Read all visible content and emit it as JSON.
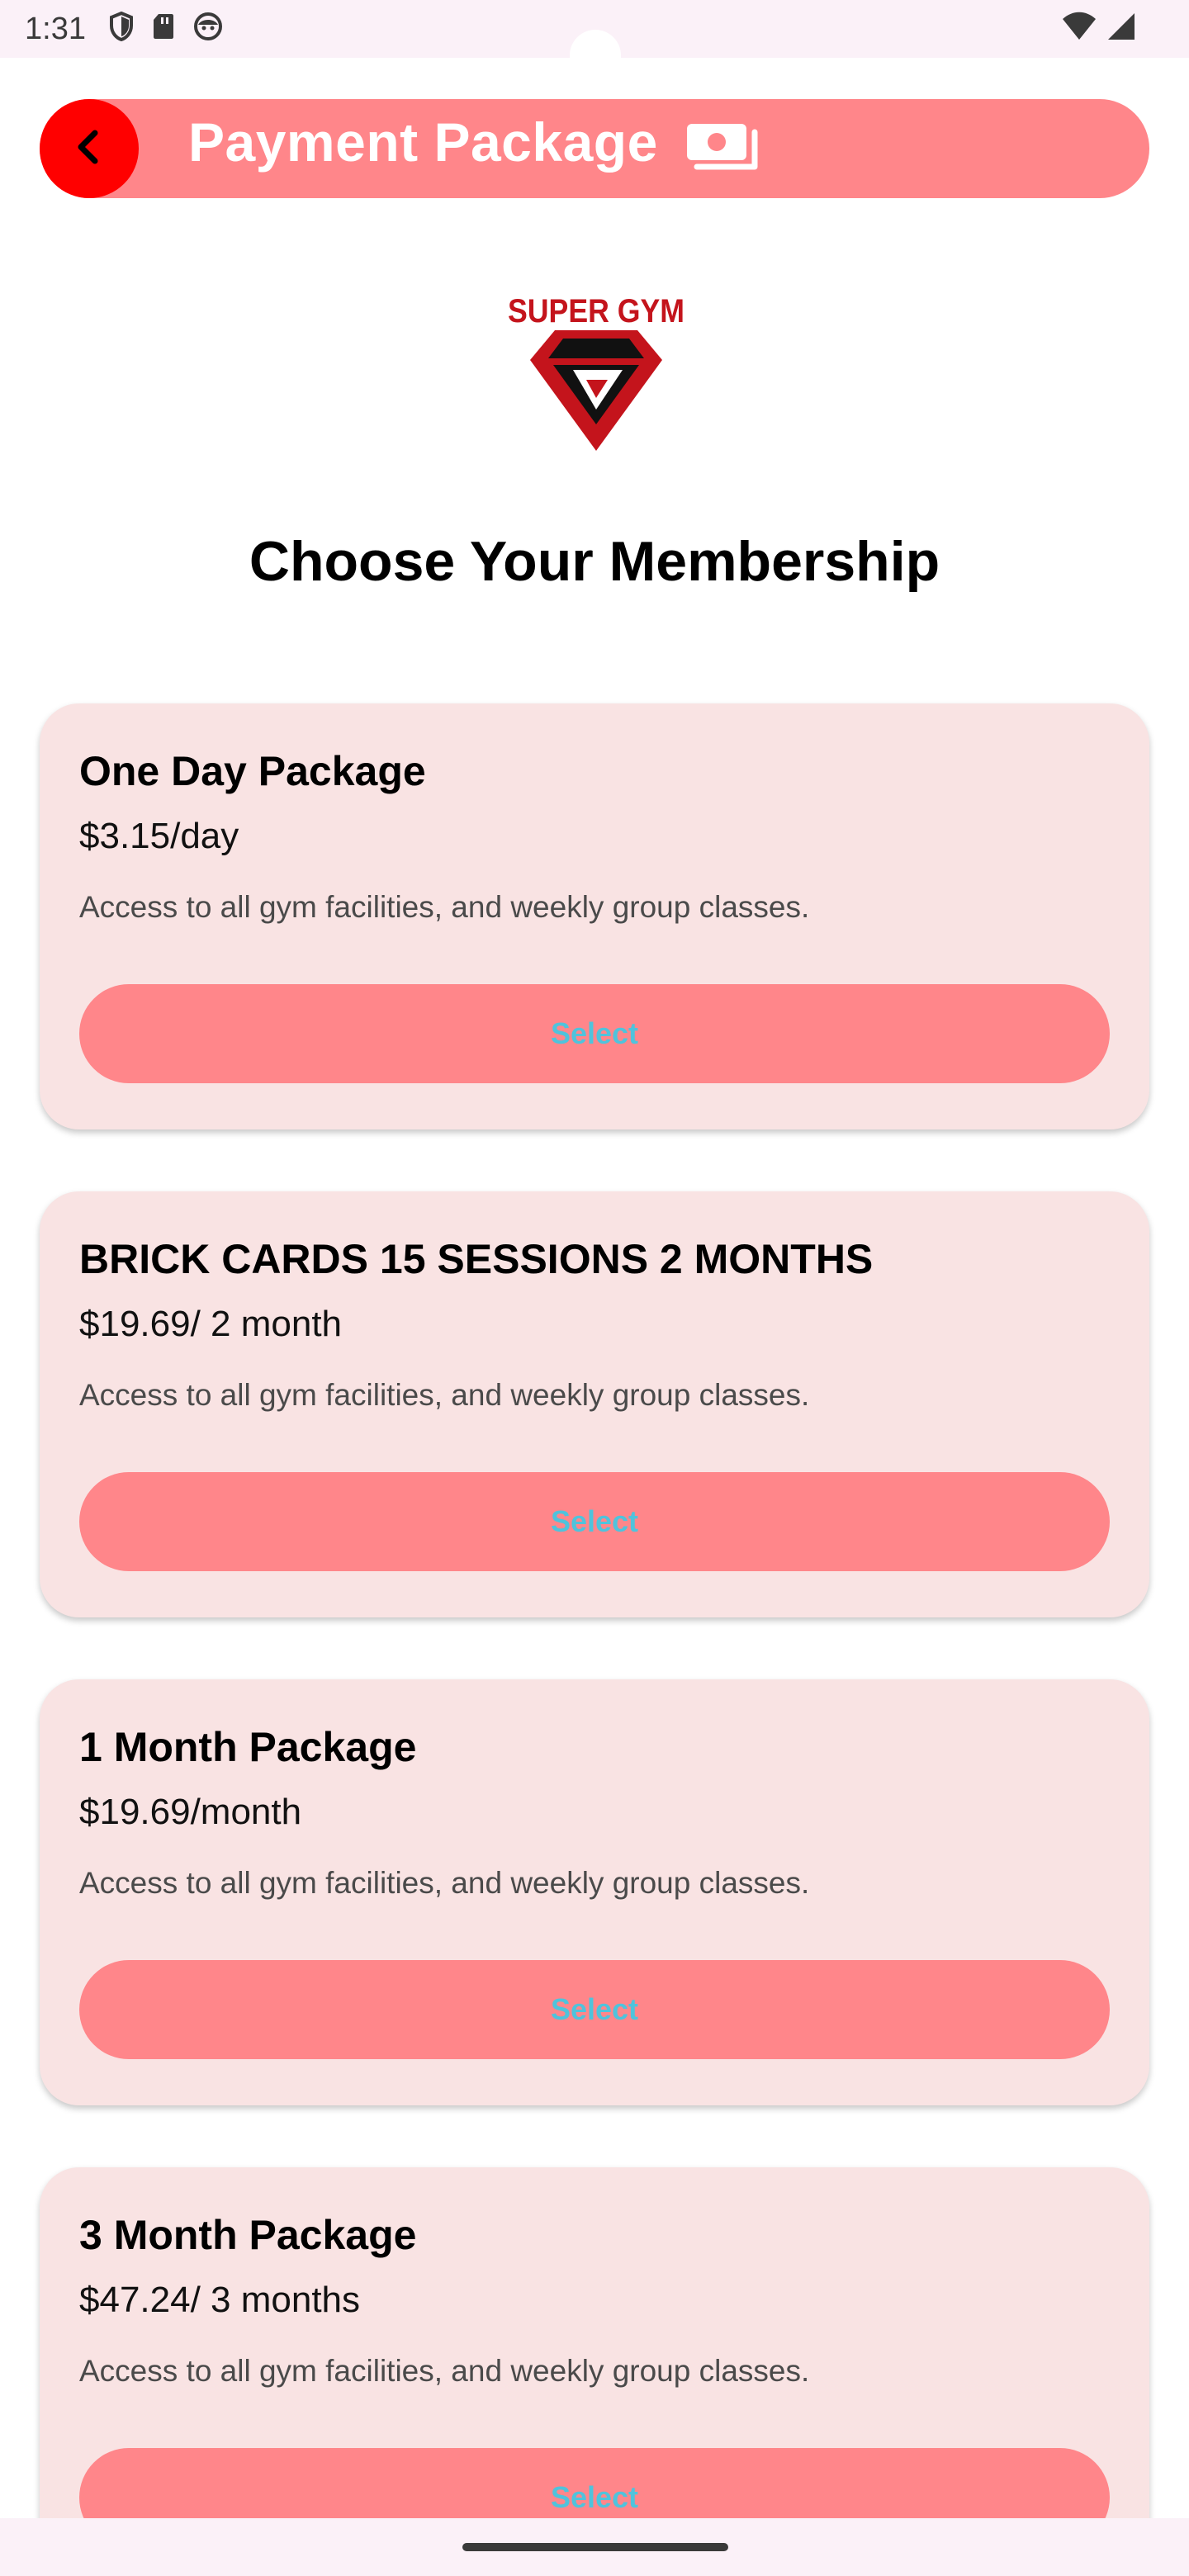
{
  "status_bar": {
    "time": "1:31",
    "icons_left": [
      "shield-icon",
      "sd-card-icon",
      "face-icon"
    ],
    "icons_right": [
      "wifi-icon",
      "cellular-signal-icon"
    ]
  },
  "header": {
    "title": "Payment Package",
    "back_icon": "chevron-left-icon",
    "title_icon": "payment-icon",
    "colors": {
      "bar": "#ff868a",
      "back_button": "#ff0000"
    }
  },
  "logo": {
    "text": "SUPER GYM",
    "colors": {
      "primary": "#c4141c",
      "dark": "#111111"
    }
  },
  "page_title": "Choose Your Membership",
  "packages": [
    {
      "title": "One Day Package",
      "price": "$3.15/day",
      "description": "Access to all gym facilities, and weekly group classes.",
      "button_label": "Select"
    },
    {
      "title": "BRICK CARDS 15 SESSIONS 2 MONTHS",
      "price": "$19.69/ 2 month",
      "description": "Access to all gym facilities, and weekly group classes.",
      "button_label": "Select"
    },
    {
      "title": "1 Month Package",
      "price": "$19.69/month",
      "description": "Access to all gym facilities, and weekly group classes.",
      "button_label": "Select"
    },
    {
      "title": "3 Month Package",
      "price": "$47.24/ 3 months",
      "description": "Access to all gym facilities, and weekly group classes.",
      "button_label": "Select"
    }
  ],
  "colors": {
    "card_background": "#f9e3e3",
    "button_background": "#ff868a",
    "button_text": "#4fc3dc"
  }
}
